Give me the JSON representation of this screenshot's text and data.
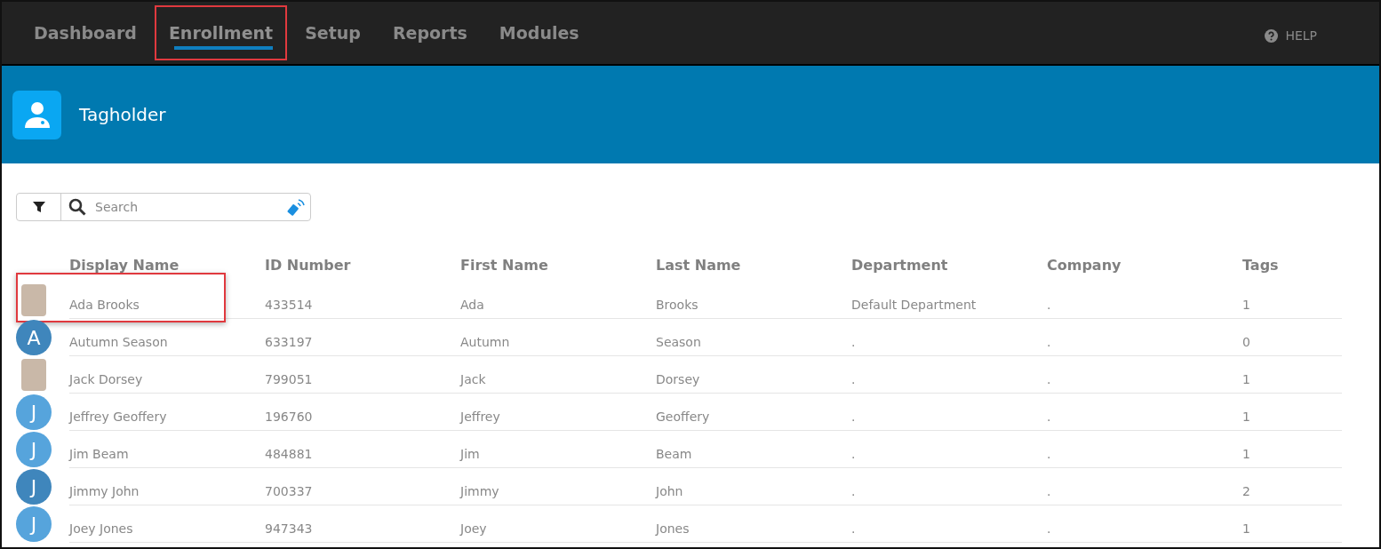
{
  "nav": {
    "tabs": [
      {
        "label": "Dashboard",
        "selected": false,
        "highlighted": false
      },
      {
        "label": "Enrollment",
        "selected": true,
        "highlighted": true
      },
      {
        "label": "Setup",
        "selected": false,
        "highlighted": false
      },
      {
        "label": "Reports",
        "selected": false,
        "highlighted": false
      },
      {
        "label": "Modules",
        "selected": false,
        "highlighted": false
      }
    ],
    "help": "HELP"
  },
  "header": {
    "title": "Tagholder"
  },
  "search": {
    "placeholder": "Search"
  },
  "table": {
    "columns": [
      "Display Name",
      "ID Number",
      "First Name",
      "Last Name",
      "Department",
      "Company",
      "Tags"
    ],
    "rows": [
      {
        "avatar": {
          "kind": "photo"
        },
        "highlighted": true,
        "cells": [
          "Ada Brooks",
          "433514",
          "Ada",
          "Brooks",
          "Default Department",
          ".",
          "1"
        ]
      },
      {
        "avatar": {
          "kind": "initial",
          "letter": "A",
          "color": "#3f86bc"
        },
        "highlighted": false,
        "cells": [
          "Autumn Season",
          "633197",
          "Autumn",
          "Season",
          ".",
          ".",
          "0"
        ]
      },
      {
        "avatar": {
          "kind": "photo"
        },
        "highlighted": false,
        "cells": [
          "Jack Dorsey",
          "799051",
          "Jack",
          "Dorsey",
          ".",
          ".",
          "1"
        ]
      },
      {
        "avatar": {
          "kind": "initial",
          "letter": "J",
          "color": "#56a4dc"
        },
        "highlighted": false,
        "cells": [
          "Jeffrey Geoffery",
          "196760",
          "Jeffrey",
          "Geoffery",
          ".",
          ".",
          "1"
        ]
      },
      {
        "avatar": {
          "kind": "initial",
          "letter": "J",
          "color": "#56a4dc"
        },
        "highlighted": false,
        "cells": [
          "Jim Beam",
          "484881",
          "Jim",
          "Beam",
          ".",
          ".",
          "1"
        ]
      },
      {
        "avatar": {
          "kind": "initial",
          "letter": "J",
          "color": "#3f86bc"
        },
        "highlighted": false,
        "cells": [
          "Jimmy John",
          "700337",
          "Jimmy",
          "John",
          ".",
          ".",
          "2"
        ]
      },
      {
        "avatar": {
          "kind": "initial",
          "letter": "J",
          "color": "#56a4dc"
        },
        "highlighted": false,
        "cells": [
          "Joey Jones",
          "947343",
          "Joey",
          "Jones",
          ".",
          ".",
          "1"
        ]
      }
    ]
  }
}
